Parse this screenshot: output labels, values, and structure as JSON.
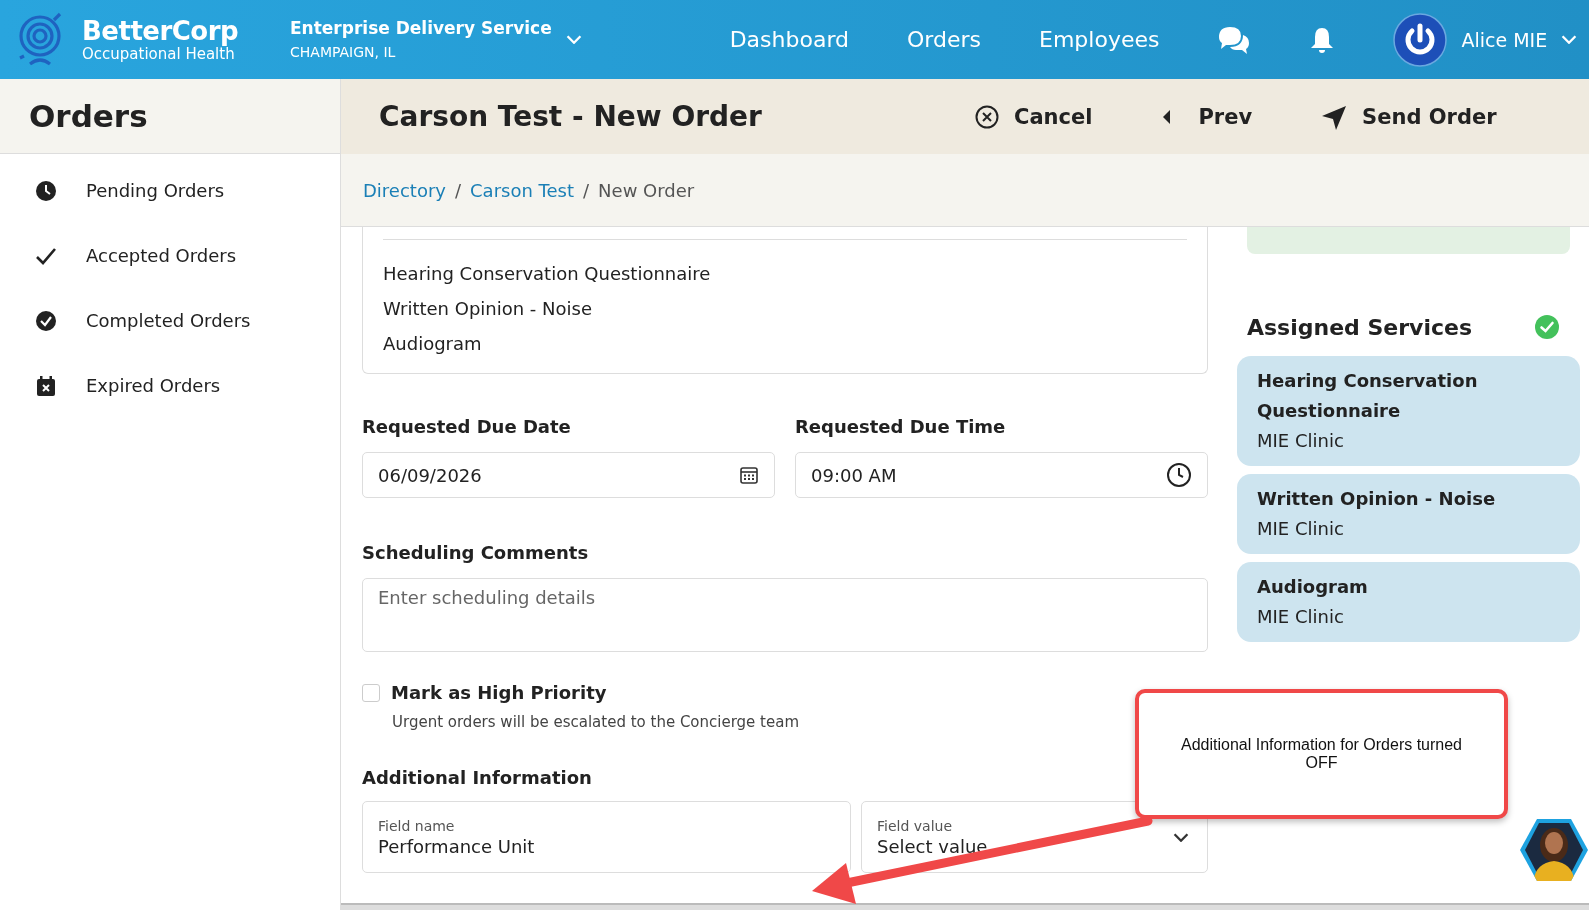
{
  "header": {
    "brand": {
      "name": "BetterCorp",
      "tagline": "Occupational Health"
    },
    "account": {
      "name": "Enterprise Delivery Service",
      "location": "CHAMPAIGN, IL"
    },
    "nav": [
      {
        "label": "Dashboard"
      },
      {
        "label": "Orders"
      },
      {
        "label": "Employees"
      }
    ],
    "user": {
      "name": "Alice MIE"
    }
  },
  "sidebar": {
    "title": "Orders",
    "items": [
      {
        "kind": "pending",
        "label": "Pending Orders"
      },
      {
        "kind": "accepted",
        "label": "Accepted Orders"
      },
      {
        "kind": "completed",
        "label": "Completed Orders"
      },
      {
        "kind": "expired",
        "label": "Expired Orders"
      }
    ]
  },
  "order": {
    "title": "Carson Test - New Order",
    "actions": [
      {
        "kind": "cancel",
        "label": "Cancel"
      },
      {
        "kind": "prev",
        "label": "Prev"
      },
      {
        "kind": "send",
        "label": "Send Order"
      }
    ],
    "breadcrumb": [
      {
        "kind": "link",
        "label": "Directory"
      },
      {
        "kind": "separator",
        "label": "/"
      },
      {
        "kind": "link",
        "label": "Carson Test"
      },
      {
        "kind": "separator",
        "label": "/"
      },
      {
        "kind": "current",
        "label": "New Order"
      }
    ],
    "services_list": [
      "Hearing Conservation Questionnaire",
      "Written Opinion - Noise",
      "Audiogram"
    ],
    "due_date": {
      "label": "Requested Due Date",
      "value": "06/09/2026"
    },
    "due_time": {
      "label": "Requested Due Time",
      "value": "09:00  AM"
    },
    "comments": {
      "label": "Scheduling Comments",
      "placeholder": "Enter scheduling details"
    },
    "high_priority": {
      "label": "Mark as High Priority",
      "checked": false,
      "hint": "Urgent orders will be escalated to the Concierge team"
    },
    "additional_info": {
      "title": "Additional Information",
      "fields": [
        {
          "kind": "text",
          "label": "Field name",
          "value": "Performance Unit"
        },
        {
          "kind": "select",
          "label": "Field value",
          "value": "Select value"
        }
      ]
    }
  },
  "assigned_services": {
    "title": "Assigned Services",
    "complete": true,
    "items": [
      {
        "name": "Hearing Conservation Questionnaire",
        "provider": "MIE Clinic"
      },
      {
        "name": "Written Opinion - Noise",
        "provider": "MIE Clinic"
      },
      {
        "name": "Audiogram",
        "provider": "MIE Clinic"
      }
    ]
  },
  "callout": {
    "text": "Additional Information for Orders turned OFF"
  }
}
